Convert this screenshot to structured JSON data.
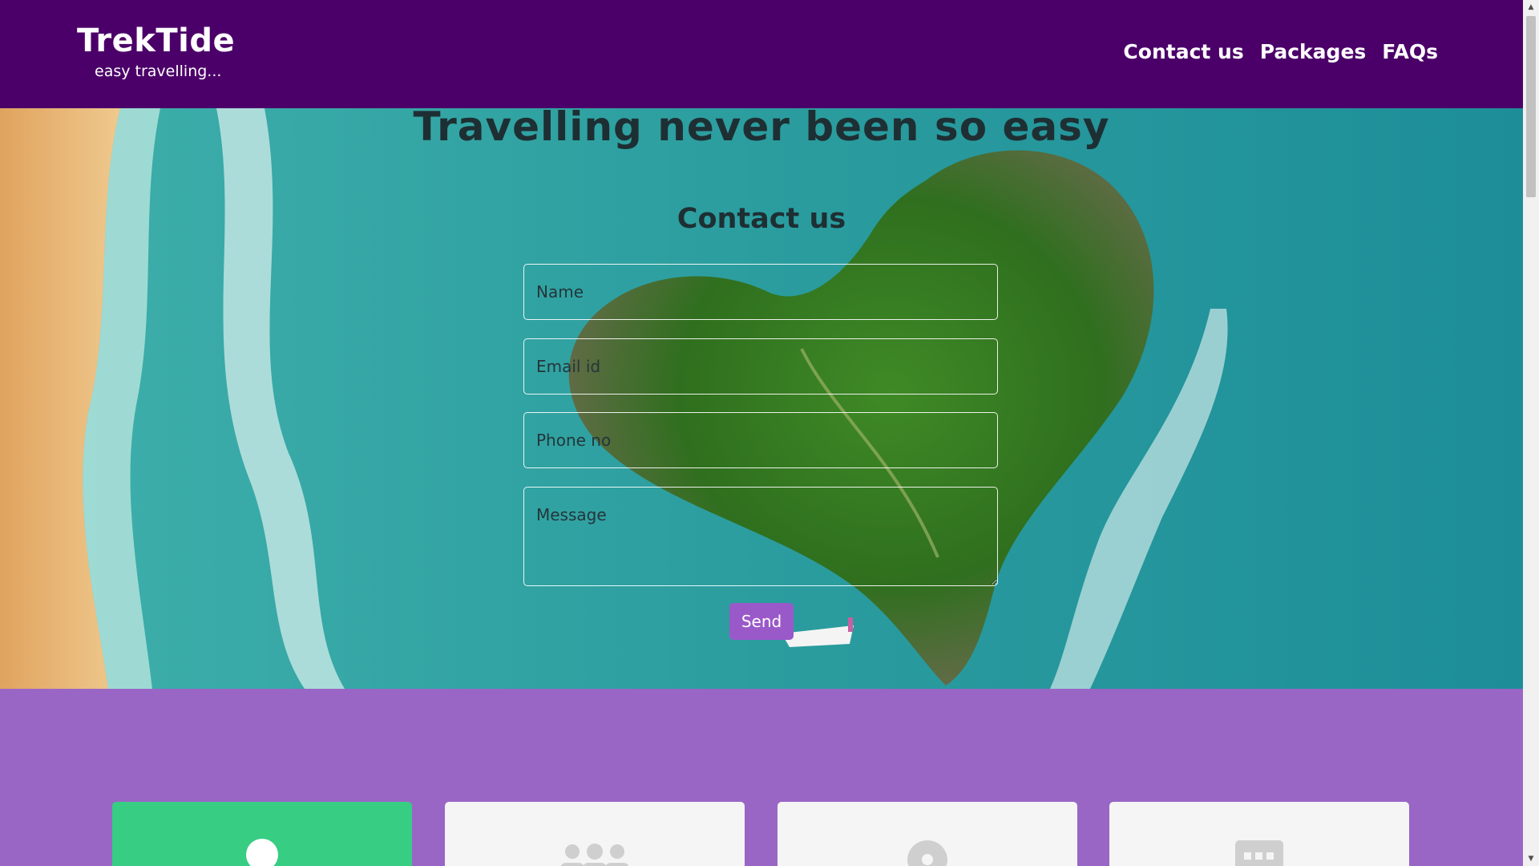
{
  "header": {
    "brand_name": "TrekTide",
    "tagline": "easy travelling...",
    "nav": [
      "Contact us",
      "Packages",
      "FAQs"
    ]
  },
  "hero": {
    "title": "Travelling never been so easy",
    "form_title": "Contact us",
    "fields": {
      "name_placeholder": "Name",
      "email_placeholder": "Email id",
      "phone_placeholder": "Phone no",
      "message_placeholder": "Message"
    },
    "send_label": "Send"
  },
  "cards": [
    {
      "icon": "person-icon",
      "active": true
    },
    {
      "icon": "group-icon",
      "active": false
    },
    {
      "icon": "location-pin-icon",
      "active": false
    },
    {
      "icon": "chat-icon",
      "active": false
    }
  ],
  "colors": {
    "header_bg": "#4b0069",
    "section_bg": "#9966c6",
    "active_card": "#37cd83",
    "card_bg": "#f5f5f5",
    "button_bg": "#9a59c9"
  }
}
